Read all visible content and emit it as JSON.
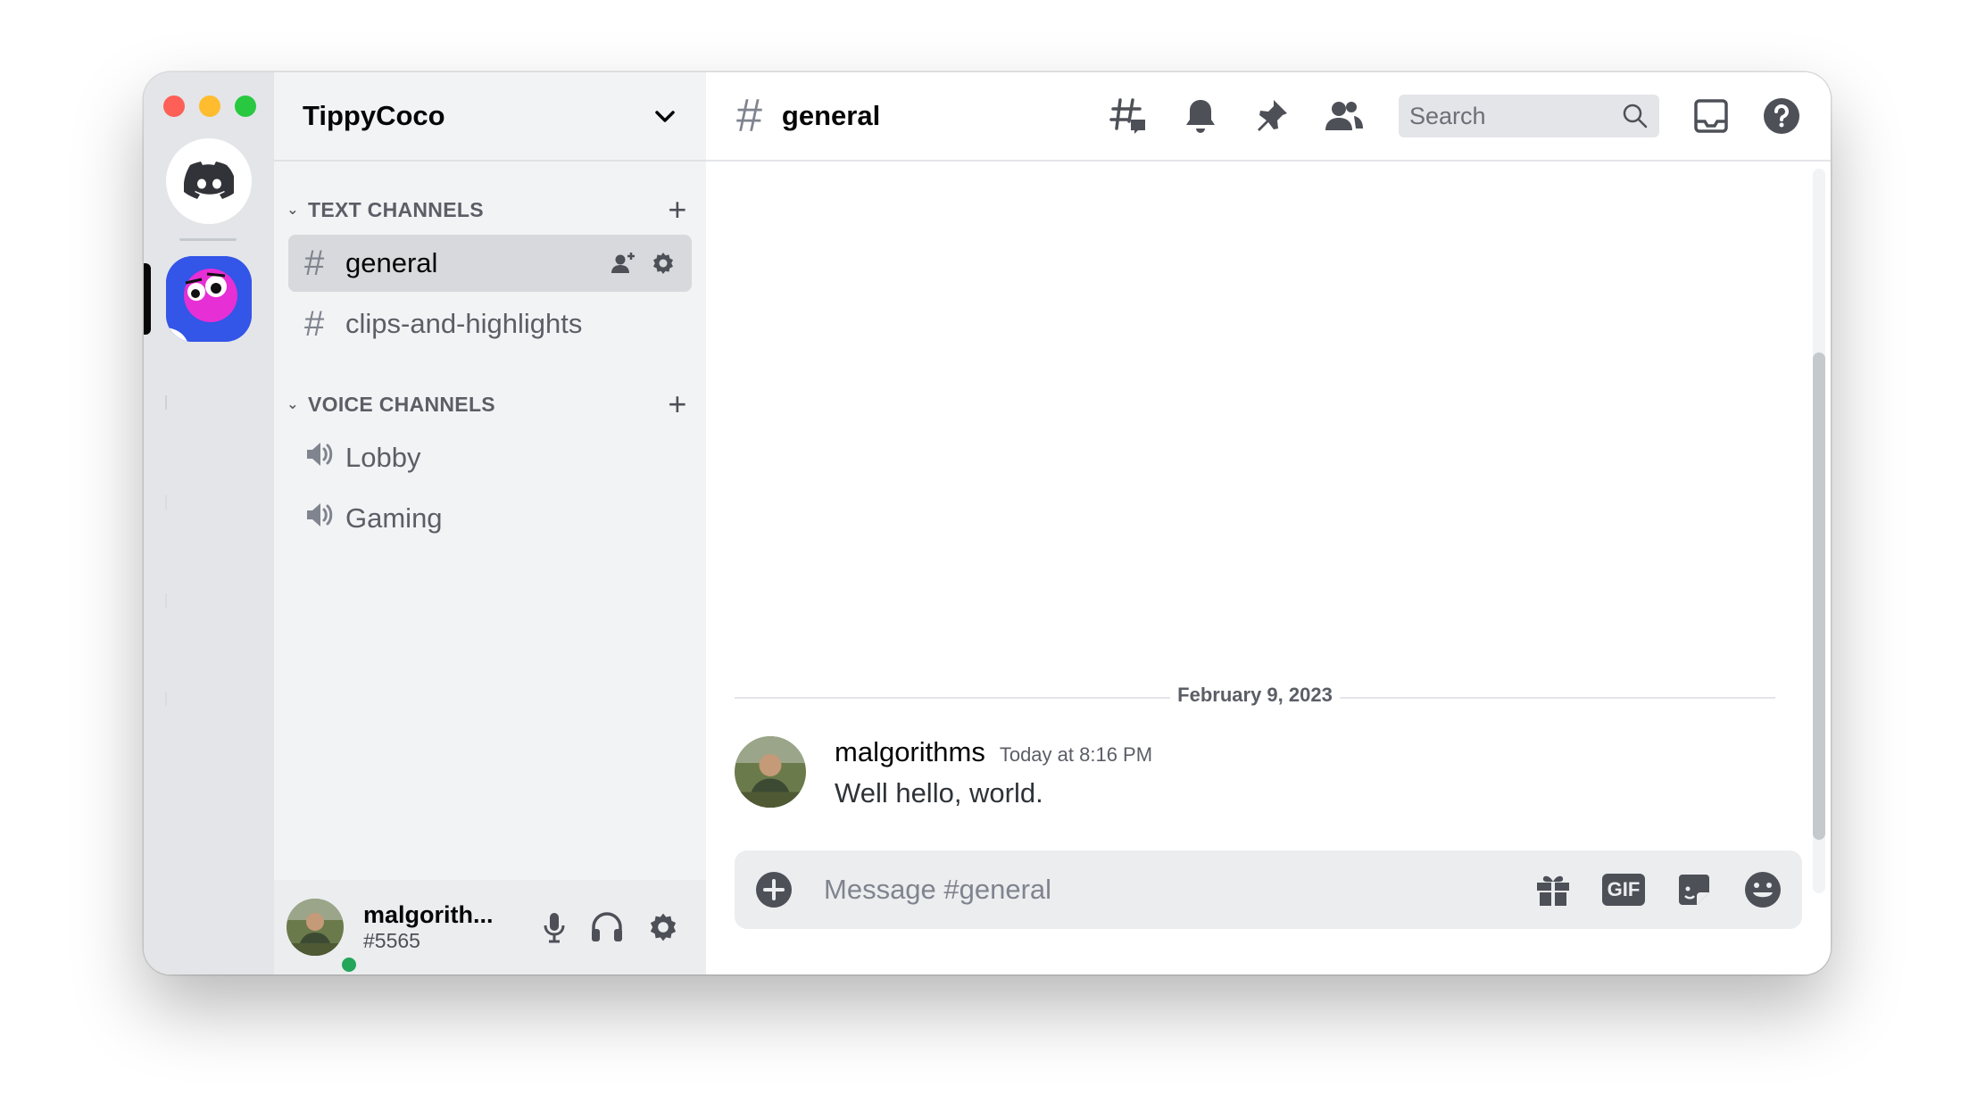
{
  "server": {
    "name": "TippyCoco"
  },
  "categories": {
    "text": {
      "label": "TEXT CHANNELS"
    },
    "voice": {
      "label": "VOICE CHANNELS"
    }
  },
  "text_channels": [
    {
      "label": "general",
      "active": true
    },
    {
      "label": "clips-and-highlights",
      "active": false
    }
  ],
  "voice_channels": [
    {
      "label": "Lobby"
    },
    {
      "label": "Gaming"
    }
  ],
  "user": {
    "name": "malgorith...",
    "tag": "#5565",
    "status_color": "#23a55a"
  },
  "channel_header": {
    "hash": "#",
    "title": "general"
  },
  "search": {
    "placeholder": "Search"
  },
  "messages": {
    "divider": "February 9, 2023",
    "items": [
      {
        "author": "malgorithms",
        "time": "Today at 8:16 PM",
        "text": "Well hello, world."
      }
    ]
  },
  "composer": {
    "placeholder": "Message #general",
    "gif_label": "GIF"
  },
  "colors": {
    "accent": "#5865f2",
    "rail_bg": "#e3e5e8",
    "sidebar_bg": "#f2f3f5",
    "active_channel": "#d7d9dc"
  },
  "icons": [
    "discord-home-icon",
    "threads-icon",
    "bell-icon",
    "pin-icon",
    "members-icon",
    "search-icon",
    "inbox-icon",
    "help-icon",
    "invite-icon",
    "gear-icon",
    "speaker-icon",
    "mic-icon",
    "headphones-icon",
    "add-icon",
    "gift-icon",
    "sticker-icon",
    "emoji-icon",
    "chevron-down-icon"
  ]
}
